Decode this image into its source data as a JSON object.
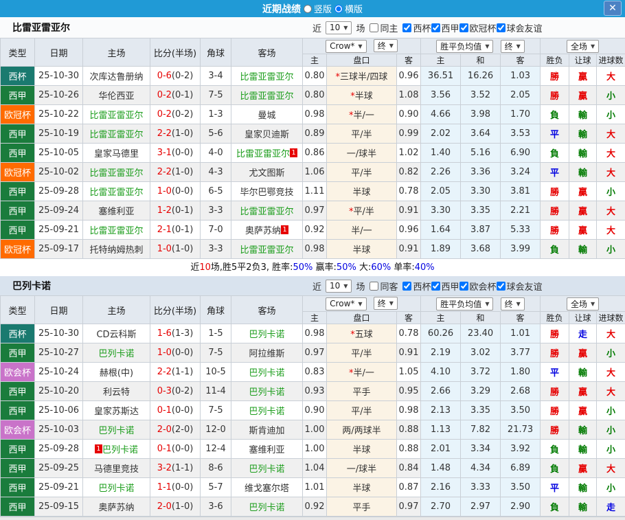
{
  "titlebar": {
    "title": "近期战绩",
    "vertical_label": "竖版",
    "horizontal_label": "横版"
  },
  "icons": {
    "close": "✕",
    "dropdown_arrow": "▼"
  },
  "colors": {
    "titlebar_bg": "#209ad6",
    "close_bg": "#4c82c4",
    "s1_bar_bg": "#fafbfc",
    "s2_bar_bg": "#d9e3ee",
    "header_bg": "#e3e9f0",
    "stripe": "#f0f0f0",
    "handicap_bg": "#fbf3e5",
    "avg_bg": "#e8f4fb",
    "border": "#c9cfd6",
    "red": "#e60000",
    "blue": "#0000e0",
    "green": "#007a00",
    "team_green": "#1a9c1a"
  },
  "league_colors": {
    "西杯": "#1a7a6f",
    "西甲": "#1a7c3c",
    "欧冠杯": "#ff6b00",
    "欧会杯": "#c973c9"
  },
  "table_header": {
    "type": "类型",
    "date": "日期",
    "home": "主场",
    "score": "比分(半场)",
    "corner": "角球",
    "away": "客场",
    "company_select": "Crow*",
    "final_select": "终",
    "avg_select": "胜平负均值",
    "scope_select": "全场",
    "home_s": "主",
    "handicap": "盘口",
    "away_s": "客",
    "home_avg": "主",
    "draw_avg": "和",
    "away_avg": "客",
    "result": "胜负",
    "handicap_res": "让球",
    "goals": "进球数"
  },
  "sections": [
    {
      "team": "比雷亚雷亚尔",
      "filter": {
        "near_label": "近",
        "games_value": "10",
        "games_label": "场",
        "same_label": "同主",
        "same_checked": false,
        "leagues": [
          "西杯",
          "西甲",
          "欧冠杯",
          "球会友谊"
        ]
      },
      "rows": [
        {
          "league": "西杯",
          "date": "25-10-30",
          "home": "次库达鲁册纳",
          "home_focus": false,
          "score": "0-6",
          "half": "(0-2)",
          "corners": "3-4",
          "away": "比雷亚雷亚尔",
          "away_focus": true,
          "crown_home": "0.80",
          "handicap": "三球半/四球",
          "handicap_star": true,
          "crown_away": "0.96",
          "avg_home": "36.51",
          "avg_draw": "16.26",
          "avg_away": "1.03",
          "result": "勝",
          "handicap_result": "贏",
          "goals": "大"
        },
        {
          "league": "西甲",
          "date": "25-10-26",
          "home": "华伦西亚",
          "home_focus": false,
          "score": "0-2",
          "half": "(0-1)",
          "corners": "7-5",
          "away": "比雷亚雷亚尔",
          "away_focus": true,
          "crown_home": "0.80",
          "handicap": "半球",
          "handicap_star": true,
          "crown_away": "1.08",
          "avg_home": "3.56",
          "avg_draw": "3.52",
          "avg_away": "2.05",
          "result": "勝",
          "handicap_result": "贏",
          "goals": "小"
        },
        {
          "league": "欧冠杯",
          "date": "25-10-22",
          "home": "比雷亚雷亚尔",
          "home_focus": true,
          "score": "0-2",
          "half": "(0-2)",
          "corners": "1-3",
          "away": "曼城",
          "away_focus": false,
          "crown_home": "0.98",
          "handicap": "半/一",
          "handicap_star": true,
          "crown_away": "0.90",
          "avg_home": "4.66",
          "avg_draw": "3.98",
          "avg_away": "1.70",
          "result": "負",
          "handicap_result": "輸",
          "goals": "小"
        },
        {
          "league": "西甲",
          "date": "25-10-19",
          "home": "比雷亚雷亚尔",
          "home_focus": true,
          "score": "2-2",
          "half": "(1-0)",
          "corners": "5-6",
          "away": "皇家贝迪斯",
          "away_focus": false,
          "crown_home": "0.89",
          "handicap": "平/半",
          "crown_away": "0.99",
          "avg_home": "2.02",
          "avg_draw": "3.64",
          "avg_away": "3.53",
          "result": "平",
          "handicap_result": "輸",
          "goals": "大"
        },
        {
          "league": "西甲",
          "date": "25-10-05",
          "home": "皇家马德里",
          "home_focus": false,
          "score": "3-1",
          "half": "(0-0)",
          "corners": "4-0",
          "away": "比雷亚雷亚尔",
          "away_focus": true,
          "away_card": "1",
          "away_card_pos": "after",
          "crown_home": "0.86",
          "handicap": "一/球半",
          "crown_away": "1.02",
          "avg_home": "1.40",
          "avg_draw": "5.16",
          "avg_away": "6.90",
          "result": "負",
          "handicap_result": "輸",
          "goals": "大"
        },
        {
          "league": "欧冠杯",
          "date": "25-10-02",
          "home": "比雷亚雷亚尔",
          "home_focus": true,
          "score": "2-2",
          "half": "(1-0)",
          "corners": "4-3",
          "away": "尤文图斯",
          "away_focus": false,
          "crown_home": "1.06",
          "handicap": "平/半",
          "crown_away": "0.82",
          "avg_home": "2.26",
          "avg_draw": "3.36",
          "avg_away": "3.24",
          "result": "平",
          "handicap_result": "輸",
          "goals": "大"
        },
        {
          "league": "西甲",
          "date": "25-09-28",
          "home": "比雷亚雷亚尔",
          "home_focus": true,
          "score": "1-0",
          "half": "(0-0)",
          "corners": "6-5",
          "away": "毕尔巴鄂竞技",
          "away_focus": false,
          "crown_home": "1.11",
          "handicap": "半球",
          "crown_away": "0.78",
          "avg_home": "2.05",
          "avg_draw": "3.30",
          "avg_away": "3.81",
          "result": "勝",
          "handicap_result": "贏",
          "goals": "小"
        },
        {
          "league": "西甲",
          "date": "25-09-24",
          "home": "塞维利亚",
          "home_focus": false,
          "score": "1-2",
          "half": "(0-1)",
          "corners": "3-3",
          "away": "比雷亚雷亚尔",
          "away_focus": true,
          "crown_home": "0.97",
          "handicap": "平/半",
          "handicap_star": true,
          "crown_away": "0.91",
          "avg_home": "3.30",
          "avg_draw": "3.35",
          "avg_away": "2.21",
          "result": "勝",
          "handicap_result": "贏",
          "goals": "大"
        },
        {
          "league": "西甲",
          "date": "25-09-21",
          "home": "比雷亚雷亚尔",
          "home_focus": true,
          "score": "2-1",
          "half": "(0-1)",
          "corners": "7-0",
          "away": "奥萨苏纳",
          "away_focus": false,
          "away_card": "1",
          "away_card_pos": "after",
          "crown_home": "0.92",
          "handicap": "半/一",
          "crown_away": "0.96",
          "avg_home": "1.64",
          "avg_draw": "3.87",
          "avg_away": "5.33",
          "result": "勝",
          "handicap_result": "贏",
          "goals": "大"
        },
        {
          "league": "欧冠杯",
          "date": "25-09-17",
          "home": "托特纳姆热刺",
          "home_focus": false,
          "score": "1-0",
          "half": "(1-0)",
          "corners": "3-3",
          "away": "比雷亚雷亚尔",
          "away_focus": true,
          "crown_home": "0.98",
          "handicap": "半球",
          "crown_away": "0.91",
          "avg_home": "1.89",
          "avg_draw": "3.68",
          "avg_away": "3.99",
          "result": "負",
          "handicap_result": "輸",
          "goals": "小"
        }
      ],
      "summary_parts": [
        {
          "text": "近"
        },
        {
          "text": "10",
          "color": "red"
        },
        {
          "text": "场,胜5平2负3, "
        },
        {
          "text": "胜率:"
        },
        {
          "text": "50%",
          "color": "blue"
        },
        {
          "text": " 赢率:"
        },
        {
          "text": "50%",
          "color": "blue"
        },
        {
          "text": " 大:"
        },
        {
          "text": "60%",
          "color": "blue"
        },
        {
          "text": " 单率:"
        },
        {
          "text": "40%",
          "color": "blue"
        }
      ]
    },
    {
      "team": "巴列卡诺",
      "filter": {
        "near_label": "近",
        "games_value": "10",
        "games_label": "场",
        "same_label": "同客",
        "same_checked": false,
        "leagues": [
          "西杯",
          "西甲",
          "欧会杯",
          "球会友谊"
        ]
      },
      "rows": [
        {
          "league": "西杯",
          "date": "25-10-30",
          "home": "CD云科斯",
          "home_focus": false,
          "score": "1-6",
          "half": "(1-3)",
          "corners": "1-5",
          "away": "巴列卡诺",
          "away_focus": true,
          "crown_home": "0.98",
          "handicap": "五球",
          "handicap_star": true,
          "crown_away": "0.78",
          "avg_home": "60.26",
          "avg_draw": "23.40",
          "avg_away": "1.01",
          "result": "勝",
          "handicap_result": "走",
          "goals": "大"
        },
        {
          "league": "西甲",
          "date": "25-10-27",
          "home": "巴列卡诺",
          "home_focus": true,
          "score": "1-0",
          "half": "(0-0)",
          "corners": "7-5",
          "away": "阿拉维斯",
          "away_focus": false,
          "crown_home": "0.97",
          "handicap": "平/半",
          "crown_away": "0.91",
          "avg_home": "2.19",
          "avg_draw": "3.02",
          "avg_away": "3.77",
          "result": "勝",
          "handicap_result": "贏",
          "goals": "小"
        },
        {
          "league": "欧会杯",
          "date": "25-10-24",
          "home": "赫根(中)",
          "home_focus": false,
          "score": "2-2",
          "half": "(1-1)",
          "corners": "10-5",
          "away": "巴列卡诺",
          "away_focus": true,
          "crown_home": "0.83",
          "handicap": "半/一",
          "handicap_star": true,
          "crown_away": "1.05",
          "avg_home": "4.10",
          "avg_draw": "3.72",
          "avg_away": "1.80",
          "result": "平",
          "handicap_result": "輸",
          "goals": "大"
        },
        {
          "league": "西甲",
          "date": "25-10-20",
          "home": "利云特",
          "home_focus": false,
          "score": "0-3",
          "half": "(0-2)",
          "corners": "11-4",
          "away": "巴列卡诺",
          "away_focus": true,
          "crown_home": "0.93",
          "handicap": "平手",
          "crown_away": "0.95",
          "avg_home": "2.66",
          "avg_draw": "3.29",
          "avg_away": "2.68",
          "result": "勝",
          "handicap_result": "贏",
          "goals": "大"
        },
        {
          "league": "西甲",
          "date": "25-10-06",
          "home": "皇家苏斯达",
          "home_focus": false,
          "score": "0-1",
          "half": "(0-0)",
          "corners": "7-5",
          "away": "巴列卡诺",
          "away_focus": true,
          "crown_home": "0.90",
          "handicap": "平/半",
          "crown_away": "0.98",
          "avg_home": "2.13",
          "avg_draw": "3.35",
          "avg_away": "3.50",
          "result": "勝",
          "handicap_result": "贏",
          "goals": "小"
        },
        {
          "league": "欧会杯",
          "date": "25-10-03",
          "home": "巴列卡诺",
          "home_focus": true,
          "score": "2-0",
          "half": "(2-0)",
          "corners": "12-0",
          "away": "斯肯迪加",
          "away_focus": false,
          "crown_home": "1.00",
          "handicap": "两/两球半",
          "crown_away": "0.88",
          "avg_home": "1.13",
          "avg_draw": "7.82",
          "avg_away": "21.73",
          "result": "勝",
          "handicap_result": "輸",
          "goals": "小"
        },
        {
          "league": "西甲",
          "date": "25-09-28",
          "home": "巴列卡诺",
          "home_focus": true,
          "home_card": "1",
          "home_card_pos": "before",
          "score": "0-1",
          "half": "(0-0)",
          "corners": "12-4",
          "away": "塞维利亚",
          "away_focus": false,
          "crown_home": "1.00",
          "handicap": "半球",
          "crown_away": "0.88",
          "avg_home": "2.01",
          "avg_draw": "3.34",
          "avg_away": "3.92",
          "result": "負",
          "handicap_result": "輸",
          "goals": "小"
        },
        {
          "league": "西甲",
          "date": "25-09-25",
          "home": "马德里竞技",
          "home_focus": false,
          "score": "3-2",
          "half": "(1-1)",
          "corners": "8-6",
          "away": "巴列卡诺",
          "away_focus": true,
          "crown_home": "1.04",
          "handicap": "一/球半",
          "crown_away": "0.84",
          "avg_home": "1.48",
          "avg_draw": "4.34",
          "avg_away": "6.89",
          "result": "負",
          "handicap_result": "贏",
          "goals": "大"
        },
        {
          "league": "西甲",
          "date": "25-09-21",
          "home": "巴列卡诺",
          "home_focus": true,
          "score": "1-1",
          "half": "(0-0)",
          "corners": "5-7",
          "away": "维戈塞尔塔",
          "away_focus": false,
          "crown_home": "1.01",
          "handicap": "半球",
          "crown_away": "0.87",
          "avg_home": "2.16",
          "avg_draw": "3.33",
          "avg_away": "3.50",
          "result": "平",
          "handicap_result": "輸",
          "goals": "小"
        },
        {
          "league": "西甲",
          "date": "25-09-15",
          "home": "奥萨苏纳",
          "home_focus": false,
          "score": "2-0",
          "half": "(1-0)",
          "corners": "3-6",
          "away": "巴列卡诺",
          "away_focus": true,
          "crown_home": "0.92",
          "handicap": "平手",
          "crown_away": "0.97",
          "avg_home": "2.70",
          "avg_draw": "2.97",
          "avg_away": "2.90",
          "result": "負",
          "handicap_result": "輸",
          "goals": "走"
        }
      ]
    }
  ]
}
